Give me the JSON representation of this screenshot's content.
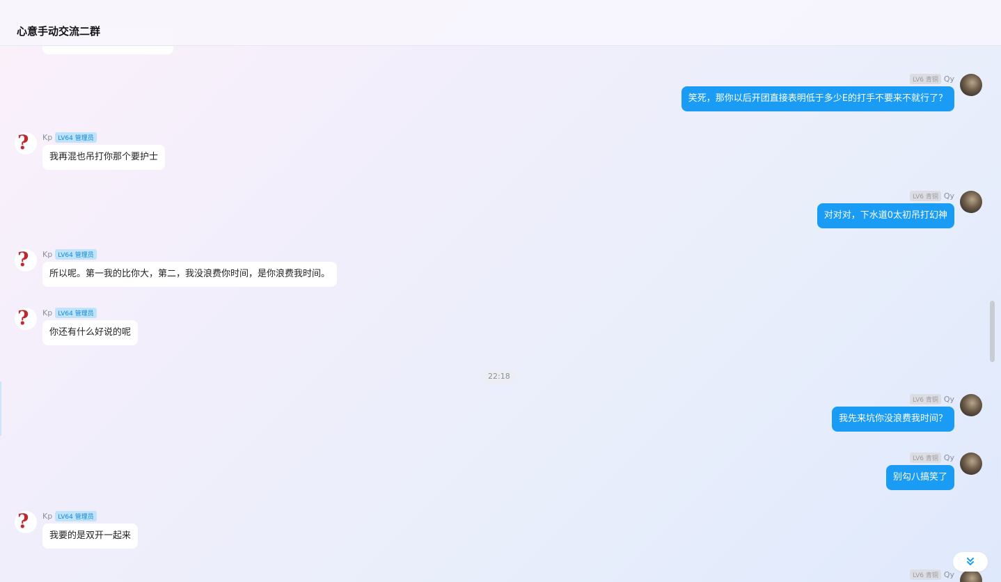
{
  "header": {
    "title": "心意手动交流二群"
  },
  "time_divider": "22:18",
  "messages": [
    {
      "side": "right",
      "name": "Qy",
      "level": "LV6 青铜",
      "text": "笑死，那你以后开团直接表明低于多少E的打手不要来不就行了？"
    },
    {
      "side": "left",
      "name": "Kp",
      "level": "LV64 管理员",
      "text": "我再混也吊打你那个要护士"
    },
    {
      "side": "right",
      "name": "Qy",
      "level": "LV6 青铜",
      "text": "对对对，下水道0太初吊打幻神"
    },
    {
      "side": "left",
      "name": "Kp",
      "level": "LV64 管理员",
      "text": "所以呢。第一我的比你大，第二，我没浪费你时间，是你浪费我时间。"
    },
    {
      "side": "left",
      "name": "Kp",
      "level": "LV64 管理员",
      "text": "你还有什么好说的呢"
    },
    {
      "side": "right",
      "name": "Qy",
      "level": "LV6 青铜",
      "text": "我先来坑你没浪费我时间？"
    },
    {
      "side": "right",
      "name": "Qy",
      "level": "LV6 青铜",
      "text": "别勾八搞笑了"
    },
    {
      "side": "left",
      "name": "Kp",
      "level": "LV64 管理员",
      "text": "我要的是双开一起来"
    },
    {
      "side": "right",
      "name": "Qy",
      "level": "LV6 青铜",
      "text": ""
    }
  ],
  "icons": {
    "left_avatar": "question-mark-avatar-icon",
    "scroll_button": "double-chevron-down-icon"
  },
  "colors": {
    "accent": "#1a9cf5",
    "admin_badge_bg": "#bfe3fb",
    "admin_badge_text": "#1388d8"
  }
}
